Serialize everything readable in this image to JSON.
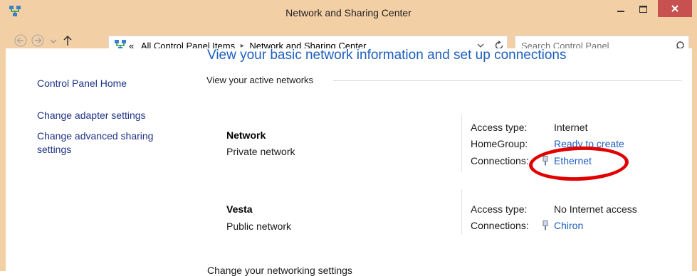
{
  "window": {
    "title": "Network and Sharing Center",
    "colors": {
      "frame": "#f3cfa5",
      "close_button": "#c75050",
      "link": "#1e5ebf",
      "nav_link": "#1e3287",
      "highlight_ellipse": "#e10000"
    }
  },
  "address_bar": {
    "overflow": "«",
    "crumbs": [
      "All Control Panel Items",
      "Network and Sharing Center"
    ],
    "separator": "▸"
  },
  "search": {
    "placeholder": "Search Control Panel"
  },
  "sidebar": {
    "items": [
      {
        "label": "Control Panel Home"
      },
      {
        "label": "Change adapter settings"
      },
      {
        "label": "Change advanced sharing"
      },
      {
        "label": "settings"
      }
    ]
  },
  "main": {
    "heading": "View your basic network information and set up connections",
    "active_networks_title": "View your active networks",
    "networks": [
      {
        "name": "Network",
        "type": "Private network",
        "access_type_label": "Access type:",
        "access_type_value": "Internet",
        "homegroup_label": "HomeGroup:",
        "homegroup_value": "Ready to create",
        "connections_label": "Connections:",
        "connection_name": "Ethernet"
      },
      {
        "name": "Vesta",
        "type": "Public network",
        "access_type_label": "Access type:",
        "access_type_value": "No Internet access",
        "connections_label": "Connections:",
        "connection_name": "Chiron"
      }
    ],
    "footer": "Change your networking settings"
  }
}
